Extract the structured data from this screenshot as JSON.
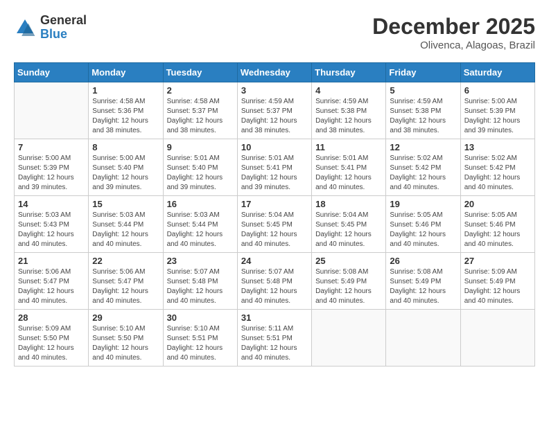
{
  "header": {
    "logo_general": "General",
    "logo_blue": "Blue",
    "month_year": "December 2025",
    "location": "Olivenca, Alagoas, Brazil"
  },
  "calendar": {
    "days_of_week": [
      "Sunday",
      "Monday",
      "Tuesday",
      "Wednesday",
      "Thursday",
      "Friday",
      "Saturday"
    ],
    "weeks": [
      [
        {
          "day": "",
          "info": ""
        },
        {
          "day": "1",
          "info": "Sunrise: 4:58 AM\nSunset: 5:36 PM\nDaylight: 12 hours\nand 38 minutes."
        },
        {
          "day": "2",
          "info": "Sunrise: 4:58 AM\nSunset: 5:37 PM\nDaylight: 12 hours\nand 38 minutes."
        },
        {
          "day": "3",
          "info": "Sunrise: 4:59 AM\nSunset: 5:37 PM\nDaylight: 12 hours\nand 38 minutes."
        },
        {
          "day": "4",
          "info": "Sunrise: 4:59 AM\nSunset: 5:38 PM\nDaylight: 12 hours\nand 38 minutes."
        },
        {
          "day": "5",
          "info": "Sunrise: 4:59 AM\nSunset: 5:38 PM\nDaylight: 12 hours\nand 38 minutes."
        },
        {
          "day": "6",
          "info": "Sunrise: 5:00 AM\nSunset: 5:39 PM\nDaylight: 12 hours\nand 39 minutes."
        }
      ],
      [
        {
          "day": "7",
          "info": "Sunrise: 5:00 AM\nSunset: 5:39 PM\nDaylight: 12 hours\nand 39 minutes."
        },
        {
          "day": "8",
          "info": "Sunrise: 5:00 AM\nSunset: 5:40 PM\nDaylight: 12 hours\nand 39 minutes."
        },
        {
          "day": "9",
          "info": "Sunrise: 5:01 AM\nSunset: 5:40 PM\nDaylight: 12 hours\nand 39 minutes."
        },
        {
          "day": "10",
          "info": "Sunrise: 5:01 AM\nSunset: 5:41 PM\nDaylight: 12 hours\nand 39 minutes."
        },
        {
          "day": "11",
          "info": "Sunrise: 5:01 AM\nSunset: 5:41 PM\nDaylight: 12 hours\nand 40 minutes."
        },
        {
          "day": "12",
          "info": "Sunrise: 5:02 AM\nSunset: 5:42 PM\nDaylight: 12 hours\nand 40 minutes."
        },
        {
          "day": "13",
          "info": "Sunrise: 5:02 AM\nSunset: 5:42 PM\nDaylight: 12 hours\nand 40 minutes."
        }
      ],
      [
        {
          "day": "14",
          "info": "Sunrise: 5:03 AM\nSunset: 5:43 PM\nDaylight: 12 hours\nand 40 minutes."
        },
        {
          "day": "15",
          "info": "Sunrise: 5:03 AM\nSunset: 5:44 PM\nDaylight: 12 hours\nand 40 minutes."
        },
        {
          "day": "16",
          "info": "Sunrise: 5:03 AM\nSunset: 5:44 PM\nDaylight: 12 hours\nand 40 minutes."
        },
        {
          "day": "17",
          "info": "Sunrise: 5:04 AM\nSunset: 5:45 PM\nDaylight: 12 hours\nand 40 minutes."
        },
        {
          "day": "18",
          "info": "Sunrise: 5:04 AM\nSunset: 5:45 PM\nDaylight: 12 hours\nand 40 minutes."
        },
        {
          "day": "19",
          "info": "Sunrise: 5:05 AM\nSunset: 5:46 PM\nDaylight: 12 hours\nand 40 minutes."
        },
        {
          "day": "20",
          "info": "Sunrise: 5:05 AM\nSunset: 5:46 PM\nDaylight: 12 hours\nand 40 minutes."
        }
      ],
      [
        {
          "day": "21",
          "info": "Sunrise: 5:06 AM\nSunset: 5:47 PM\nDaylight: 12 hours\nand 40 minutes."
        },
        {
          "day": "22",
          "info": "Sunrise: 5:06 AM\nSunset: 5:47 PM\nDaylight: 12 hours\nand 40 minutes."
        },
        {
          "day": "23",
          "info": "Sunrise: 5:07 AM\nSunset: 5:48 PM\nDaylight: 12 hours\nand 40 minutes."
        },
        {
          "day": "24",
          "info": "Sunrise: 5:07 AM\nSunset: 5:48 PM\nDaylight: 12 hours\nand 40 minutes."
        },
        {
          "day": "25",
          "info": "Sunrise: 5:08 AM\nSunset: 5:49 PM\nDaylight: 12 hours\nand 40 minutes."
        },
        {
          "day": "26",
          "info": "Sunrise: 5:08 AM\nSunset: 5:49 PM\nDaylight: 12 hours\nand 40 minutes."
        },
        {
          "day": "27",
          "info": "Sunrise: 5:09 AM\nSunset: 5:49 PM\nDaylight: 12 hours\nand 40 minutes."
        }
      ],
      [
        {
          "day": "28",
          "info": "Sunrise: 5:09 AM\nSunset: 5:50 PM\nDaylight: 12 hours\nand 40 minutes."
        },
        {
          "day": "29",
          "info": "Sunrise: 5:10 AM\nSunset: 5:50 PM\nDaylight: 12 hours\nand 40 minutes."
        },
        {
          "day": "30",
          "info": "Sunrise: 5:10 AM\nSunset: 5:51 PM\nDaylight: 12 hours\nand 40 minutes."
        },
        {
          "day": "31",
          "info": "Sunrise: 5:11 AM\nSunset: 5:51 PM\nDaylight: 12 hours\nand 40 minutes."
        },
        {
          "day": "",
          "info": ""
        },
        {
          "day": "",
          "info": ""
        },
        {
          "day": "",
          "info": ""
        }
      ]
    ]
  }
}
